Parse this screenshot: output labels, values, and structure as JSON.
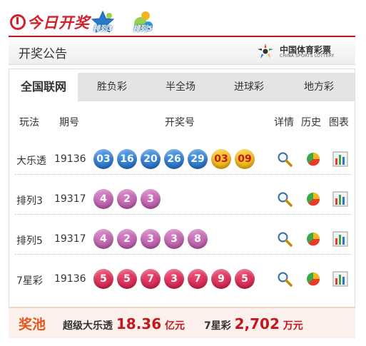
{
  "header": {
    "brand": "今日开奖",
    "game_icons": [
      {
        "label": "排列3",
        "icon": "star-icon",
        "color": "#2a78c9"
      },
      {
        "label": "排列5",
        "icon": "ball-icon",
        "color": "#f2b51d"
      }
    ]
  },
  "section": {
    "title": "开奖公告",
    "lottery_logo_cn": "中国体育彩票",
    "lottery_logo_en": "CHINA SPORTS LOTTERY"
  },
  "tabs": [
    "全国联网",
    "胜负彩",
    "半全场",
    "进球彩",
    "地方彩"
  ],
  "active_tab": 0,
  "columns": {
    "play": "玩法",
    "issue": "期号",
    "numbers": "开奖号",
    "detail": "详情",
    "history": "历史",
    "chart": "图表"
  },
  "rows": [
    {
      "name": "大乐透",
      "issue": "19136",
      "balls": [
        {
          "n": "03",
          "c": "blue"
        },
        {
          "n": "16",
          "c": "blue"
        },
        {
          "n": "20",
          "c": "blue"
        },
        {
          "n": "26",
          "c": "blue"
        },
        {
          "n": "29",
          "c": "blue"
        },
        {
          "n": "03",
          "c": "yellow"
        },
        {
          "n": "09",
          "c": "yellow"
        }
      ]
    },
    {
      "name": "排列3",
      "issue": "19317",
      "balls": [
        {
          "n": "4",
          "c": "purple"
        },
        {
          "n": "2",
          "c": "purple"
        },
        {
          "n": "3",
          "c": "purple"
        }
      ]
    },
    {
      "name": "排列5",
      "issue": "19317",
      "balls": [
        {
          "n": "4",
          "c": "purple"
        },
        {
          "n": "2",
          "c": "purple"
        },
        {
          "n": "3",
          "c": "purple"
        },
        {
          "n": "3",
          "c": "purple"
        },
        {
          "n": "8",
          "c": "purple"
        }
      ]
    },
    {
      "name": "7星彩",
      "issue": "19136",
      "balls": [
        {
          "n": "5",
          "c": "red"
        },
        {
          "n": "5",
          "c": "red"
        },
        {
          "n": "7",
          "c": "red"
        },
        {
          "n": "3",
          "c": "red"
        },
        {
          "n": "7",
          "c": "red"
        },
        {
          "n": "9",
          "c": "red"
        },
        {
          "n": "5",
          "c": "red"
        }
      ]
    }
  ],
  "row_icons": {
    "detail": "magnifier-icon",
    "history": "pie-chart-icon",
    "chart": "bar-chart-icon"
  },
  "pool": {
    "title": "奖池",
    "items": [
      {
        "label": "超级大乐透",
        "value": "18.36",
        "unit": "亿元"
      },
      {
        "label": "7星彩",
        "value": "2,702",
        "unit": "万元"
      }
    ]
  },
  "colors": {
    "brand_red": "#c4161c",
    "pool_orange": "#e2551c",
    "tab_bg": "#e4e4e4"
  }
}
